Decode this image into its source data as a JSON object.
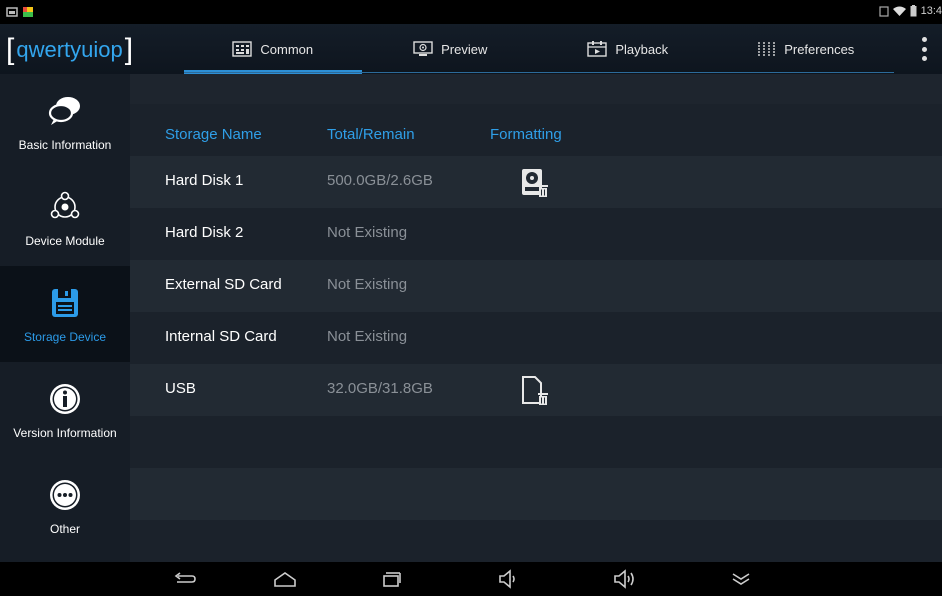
{
  "status_bar": {
    "time": "13:4",
    "icons": [
      "screenshot-icon",
      "gallery-icon",
      "alarm-icon",
      "wifi-icon",
      "battery-icon"
    ]
  },
  "header": {
    "app_name": "qwertyuiop",
    "tabs": [
      {
        "label": "Common",
        "icon": "common-grid-icon",
        "active": true
      },
      {
        "label": "Preview",
        "icon": "preview-monitor-icon",
        "active": false
      },
      {
        "label": "Playback",
        "icon": "playback-calendar-icon",
        "active": false
      },
      {
        "label": "Preferences",
        "icon": "preferences-sliders-icon",
        "active": false
      }
    ],
    "overflow_icon": "more-vertical-icon"
  },
  "sidebar": {
    "items": [
      {
        "label": "Basic Information",
        "icon": "chat-bubbles-icon",
        "active": false
      },
      {
        "label": "Device Module",
        "icon": "module-nodes-icon",
        "active": false
      },
      {
        "label": "Storage Device",
        "icon": "floppy-disk-icon",
        "active": true
      },
      {
        "label": "Version Information",
        "icon": "info-icon",
        "active": false
      },
      {
        "label": "Other",
        "icon": "more-dots-icon",
        "active": false
      }
    ]
  },
  "storage_table": {
    "headers": [
      "Storage Name",
      "Total/Remain",
      "Formatting"
    ],
    "rows": [
      {
        "name": "Hard Disk 1",
        "value": "500.0GB/2.6GB",
        "format_icon": "format-harddisk-icon"
      },
      {
        "name": "Hard Disk 2",
        "value": "Not Existing",
        "format_icon": null
      },
      {
        "name": "External SD Card",
        "value": "Not Existing",
        "format_icon": null
      },
      {
        "name": "Internal SD Card",
        "value": "Not Existing",
        "format_icon": null
      },
      {
        "name": "USB",
        "value": "32.0GB/31.8GB",
        "format_icon": "format-usb-icon"
      }
    ]
  },
  "nav_bar": {
    "buttons": [
      "back-icon",
      "home-icon",
      "recents-icon",
      "volume-down-icon",
      "volume-up-icon",
      "collapse-icon"
    ]
  },
  "colors": {
    "accent": "#2f9fe8",
    "header_bg": "#141d28",
    "sidebar_bg": "#161d26",
    "content_bg": "#1b222b",
    "muted_text": "#8a9097"
  }
}
